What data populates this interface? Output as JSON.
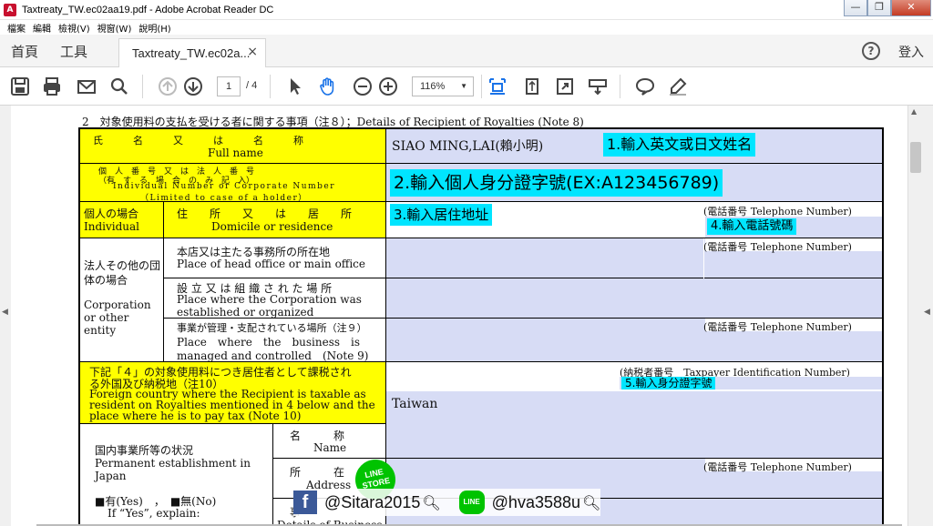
{
  "window": {
    "title": "Taxtreaty_TW.ec02aa19.pdf - Adobe Acrobat Reader DC",
    "controls": [
      "—",
      "❐",
      "✕"
    ]
  },
  "menu": [
    "檔案",
    "編輯",
    "檢視(V)",
    "視窗(W)",
    "說明(H)"
  ],
  "tabs": {
    "home": "首頁",
    "tools": "工具",
    "document": "Taxtreaty_TW.ec02a...",
    "sign_in": "登入"
  },
  "toolbar": {
    "page_current": "1",
    "page_total": "/ 4",
    "zoom": "116%"
  },
  "form": {
    "section_heading": "2　対象使用料の支払を受ける者に関する事項（注８）；Details of Recipient of Royalties (Note 8)",
    "full_name": {
      "label_jp": "氏　　　名　　　又　　　は　　　名　　　称",
      "label_en": "Full name",
      "value": "SIAO MING,LAI(賴小明)",
      "note": "1.輸入英文或日文姓名"
    },
    "id_number": {
      "label_jp": "個　人　番　号　又　は　法　人　番　号",
      "label_jp2": "（有　す　る　場　合　の　み　記　入）",
      "label_en": "Individual Number or Corporate Number",
      "label_en2": "（Limited to case of a holder）",
      "note": "2.輸入個人身分證字號(EX:A123456789)"
    },
    "individual": {
      "label_jp": "個人の場合",
      "label_en": "Individual",
      "domicile_jp": "住　　所　　又　　は　　居　　所",
      "domicile_en": "Domicile or residence",
      "note_address": "3.輸入居住地址",
      "phone_label": "(電話番号 Telephone Number)",
      "note_phone": "4.輸入電話號碼"
    },
    "corporation": {
      "label_jp": "法人その他の団体の場合",
      "label_en1": "Corporation",
      "label_en2": "or other",
      "label_en3": "entity",
      "head_office_jp": "本店又は主たる事務所の所在地",
      "head_office_en": "Place of head office or main office",
      "established_jp": "設 立 又 は 組 織 さ れ た 場 所",
      "established_en1": "Place where the Corporation was",
      "established_en2": "established or organized",
      "managed_jp": "事業が管理・支配されている場所（注９）",
      "managed_en1": "Place　where　the　business　is",
      "managed_en2": "managed and controlled　(Note 9)",
      "phone_label": "(電話番号 Telephone Number)"
    },
    "taxable": {
      "label_jp1": "下記「４」の対象使用料につき居住者として課税され",
      "label_jp2": "る外国及び納税地（注10）",
      "label_en1": "Foreign country where the Recipient is taxable as",
      "label_en2": "resident on Royalties mentioned in 4 below and the",
      "label_en3": "place where he is to pay tax (Note 10)",
      "taxpayer_label": "(納税者番号　Taxpayer Identification Number)",
      "note_taxpayer": "5.輸入身分證字號",
      "country": "Taiwan"
    },
    "pe": {
      "label_jp": "国内事業所等の状況",
      "label_en1": "Permanent establishment in",
      "label_en2": "Japan",
      "yes_no": "■有(Yes)　，　■無(No)",
      "if_yes": "If “Yes”, explain:",
      "name_jp": "名　　　称",
      "name_en": "Name",
      "address_jp": "所　　　在",
      "address_en": "Address",
      "details_jp": "事",
      "details_en": "Details of Business",
      "phone_label": "(電話番号 Telephone Number)"
    }
  },
  "overlay": {
    "facebook_handle": "@Sitara2015",
    "line_handle": "@hva3588u",
    "line_store": "LINE STORE"
  }
}
